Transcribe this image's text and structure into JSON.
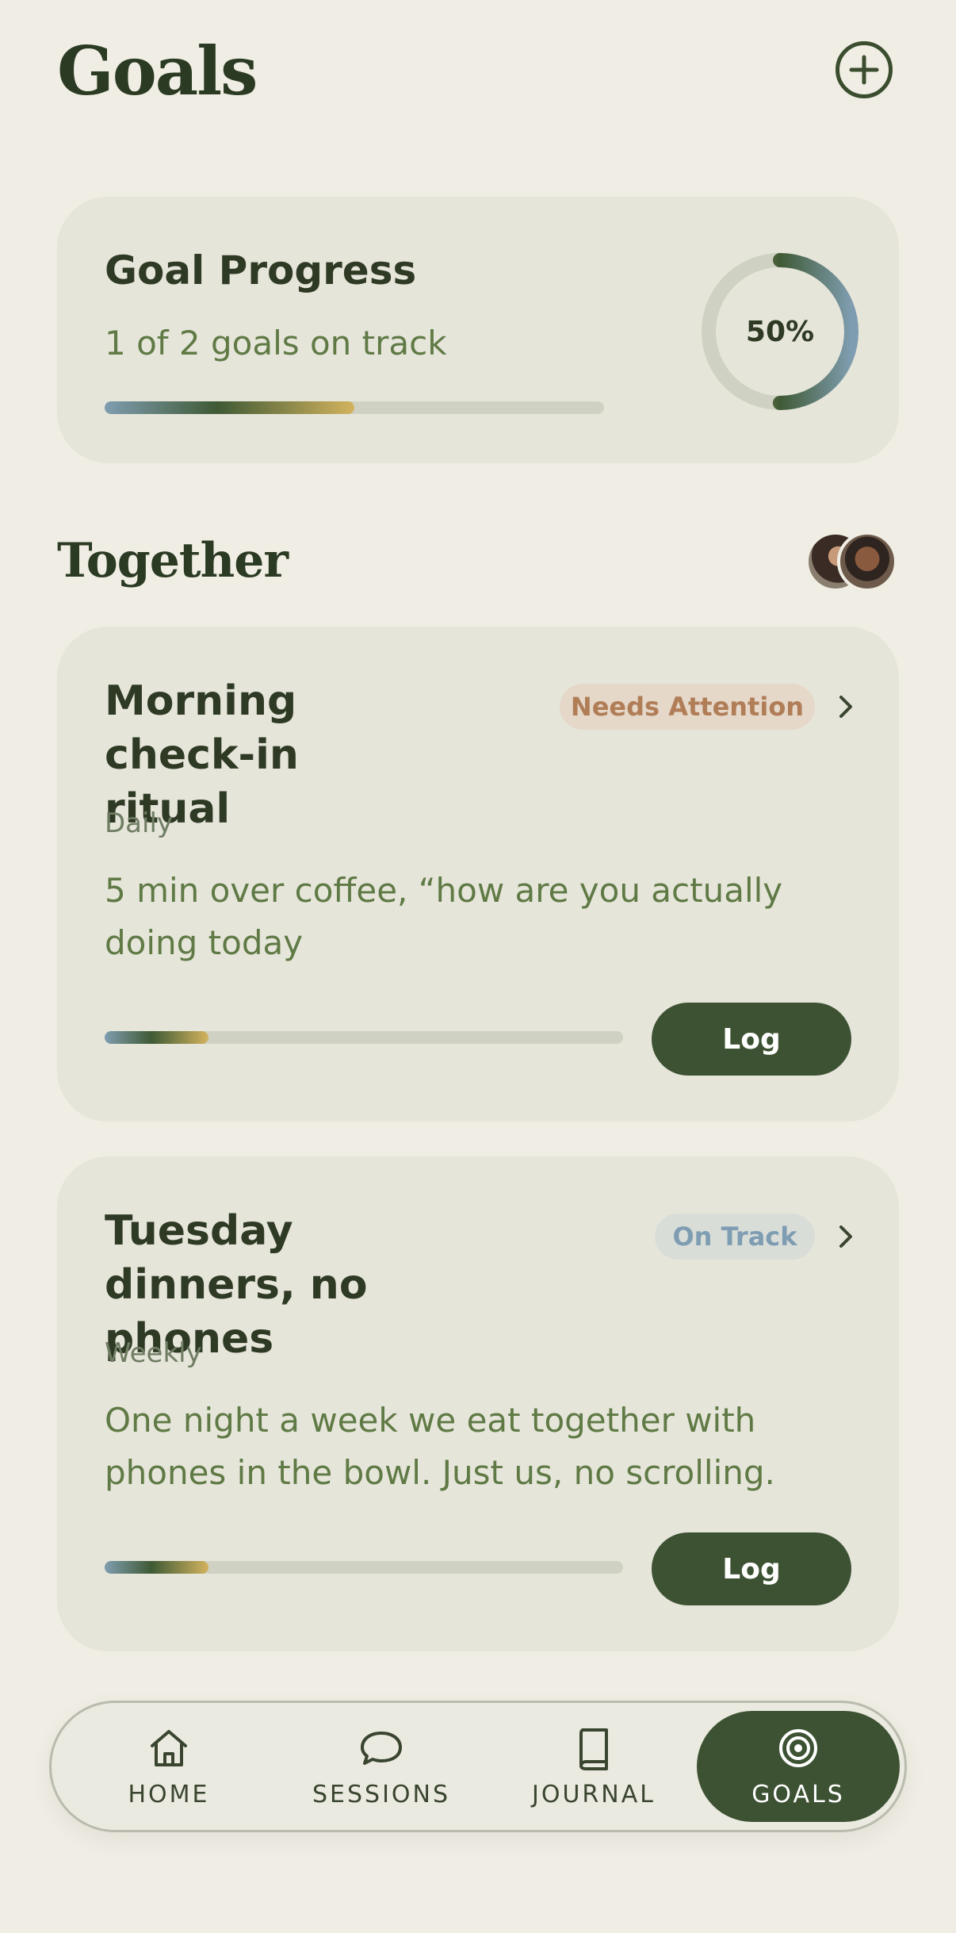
{
  "header": {
    "title": "Goals",
    "add_icon": "plus-circle-icon"
  },
  "progress": {
    "title": "Goal Progress",
    "subtitle": "1 of 2 goals on track",
    "percent_label": "50%",
    "percent": 0.5,
    "bar_fraction": 0.5
  },
  "together": {
    "title": "Together",
    "goals": [
      {
        "title": "Morning check-in ritual",
        "status": "Needs Attention",
        "frequency": "Daily",
        "description": "5 min over coffee, “how are you actually doing today",
        "progress_fraction": 0.2,
        "log_label": "Log"
      },
      {
        "title": "Tuesday dinners, no phones",
        "status": "On Track",
        "frequency": "Weekly",
        "description": "One night a week we eat together with phones in the bowl. Just us, no scrolling.",
        "progress_fraction": 0.2,
        "log_label": "Log"
      }
    ]
  },
  "nav": {
    "items": [
      {
        "label": "HOME",
        "icon": "home-icon"
      },
      {
        "label": "SESSIONS",
        "icon": "chat-bubble-icon"
      },
      {
        "label": "JOURNAL",
        "icon": "book-icon"
      },
      {
        "label": "GOALS",
        "icon": "target-icon",
        "active": true
      }
    ]
  },
  "colors": {
    "background": "#f0eee4",
    "card": "#e6e5da",
    "primary": "#3d5233",
    "accent_gold": "#d3b35e",
    "accent_blue": "#7f9db0",
    "attention_text": "#b07d57"
  }
}
